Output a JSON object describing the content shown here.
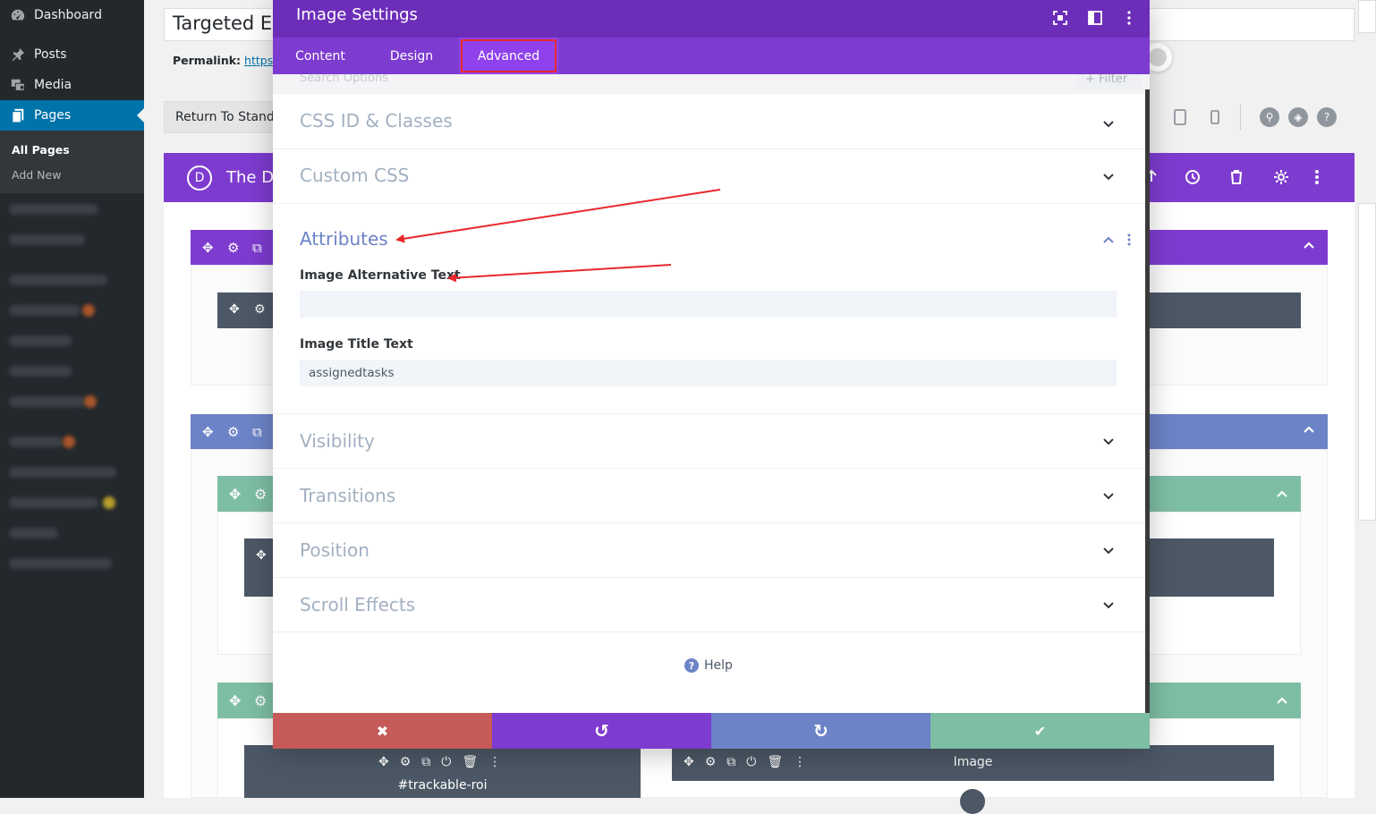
{
  "wp_sidebar": {
    "items": [
      {
        "label": "Dashboard",
        "icon": "dashboard-icon"
      },
      {
        "label": "Posts",
        "icon": "pin-icon"
      },
      {
        "label": "Media",
        "icon": "media-icon"
      },
      {
        "label": "Pages",
        "icon": "pages-icon"
      }
    ],
    "submenu": [
      {
        "label": "All Pages"
      },
      {
        "label": "Add New"
      }
    ]
  },
  "editor": {
    "title_value": "Targeted Er",
    "permalink_label": "Permalink:",
    "permalink_url": "https://",
    "return_button": "Return To Standard Editor",
    "divi_logo": "D",
    "divi_title": "The Di"
  },
  "modal": {
    "title": "Image Settings",
    "tabs": [
      {
        "label": "Content"
      },
      {
        "label": "Design"
      },
      {
        "label": "Advanced"
      }
    ],
    "search_placeholder": "Search Options",
    "filter_label": "+ Filter",
    "groups": {
      "css_id_classes": "CSS ID & Classes",
      "custom_css": "Custom CSS",
      "attributes": "Attributes",
      "visibility": "Visibility",
      "transitions": "Transitions",
      "position": "Position",
      "scroll_effects": "Scroll Effects"
    },
    "fields": {
      "alt_label": "Image Alternative Text",
      "alt_value": "",
      "title_label": "Image Title Text",
      "title_value": "assignedtasks"
    },
    "help_label": "Help",
    "footer": {
      "cancel_glyph": "✖",
      "undo_glyph": "↺",
      "redo_glyph": "↻",
      "save_glyph": "✔"
    }
  },
  "builder": {
    "module_trackable": "#trackable-roi",
    "module_image": "Image"
  },
  "colors": {
    "divi_purple": "#7e3bd0",
    "divi_purple_dark": "#6c2eb9",
    "section_blue": "#6c83c7",
    "row_green": "#7ebea5",
    "cancel_red": "#c55a58",
    "annotation_red": "#e8282d"
  }
}
